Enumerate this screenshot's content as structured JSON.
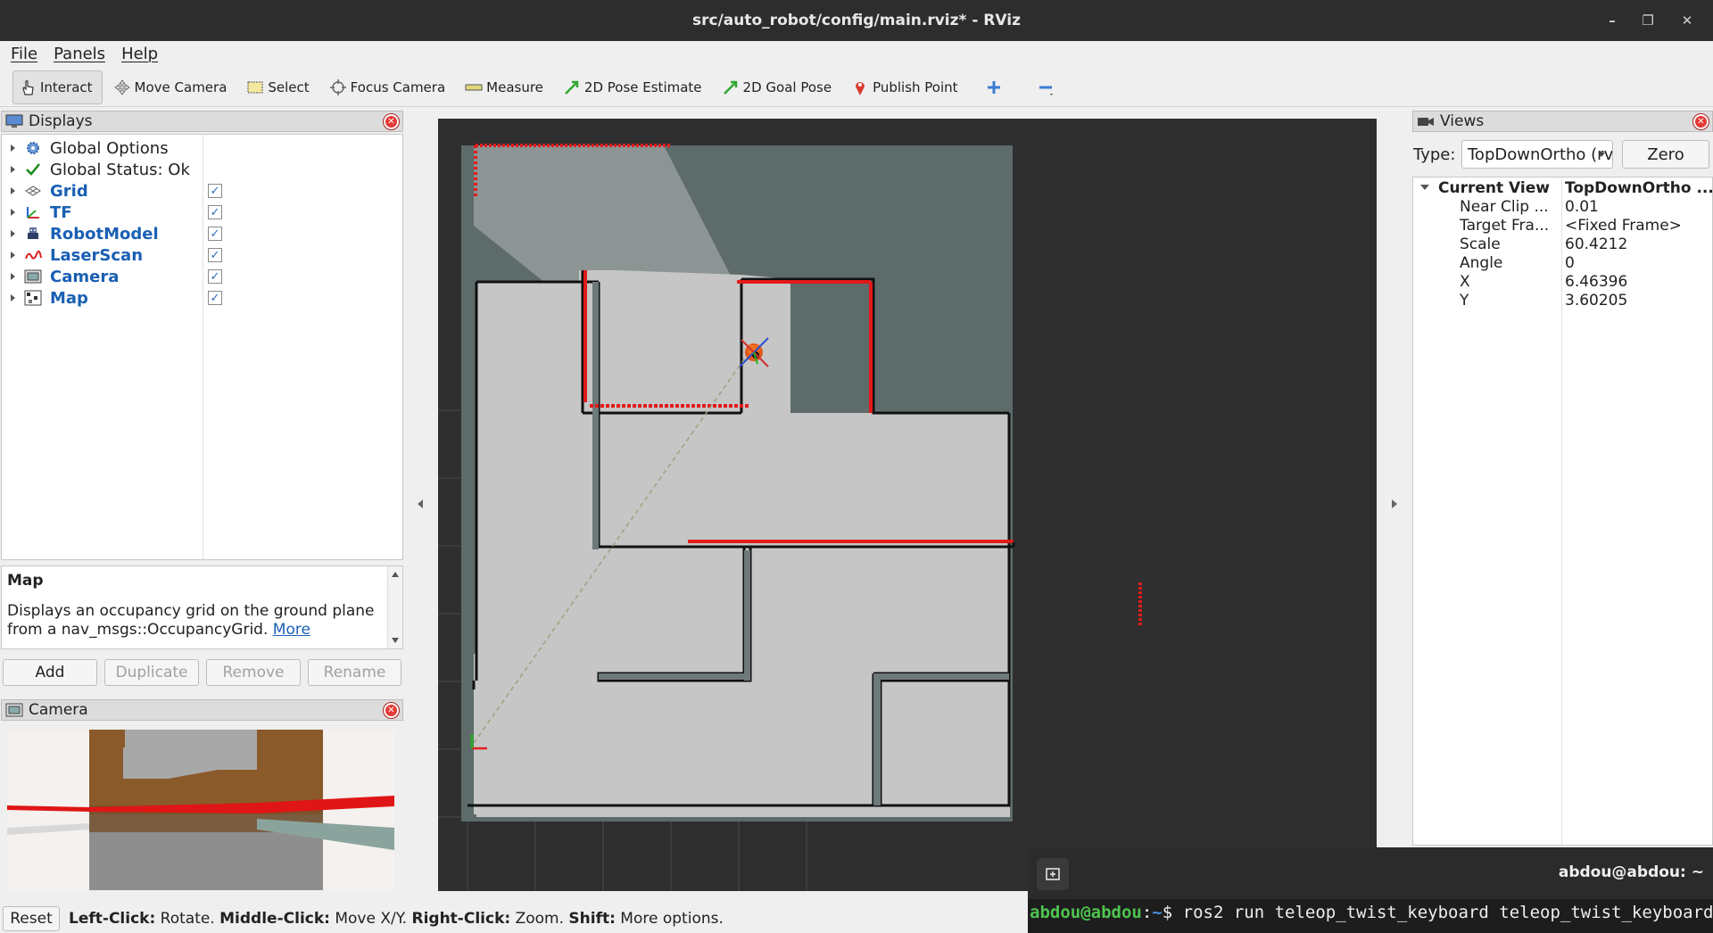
{
  "window": {
    "title": "src/auto_robot/config/main.rviz* - RViz"
  },
  "menu": [
    "File",
    "Panels",
    "Help"
  ],
  "toolbar": {
    "interact": "Interact",
    "move_camera": "Move Camera",
    "select": "Select",
    "focus_camera": "Focus Camera",
    "measure": "Measure",
    "pose_estimate": "2D Pose Estimate",
    "goal_pose": "2D Goal Pose",
    "publish_point": "Publish Point"
  },
  "displays": {
    "title": "Displays",
    "items": [
      {
        "label": "Global Options",
        "checked": null
      },
      {
        "label": "Global Status: Ok",
        "checked": null
      },
      {
        "label": "Grid",
        "checked": true
      },
      {
        "label": "TF",
        "checked": true
      },
      {
        "label": "RobotModel",
        "checked": true
      },
      {
        "label": "LaserScan",
        "checked": true
      },
      {
        "label": "Camera",
        "checked": true
      },
      {
        "label": "Map",
        "checked": true
      }
    ],
    "description_title": "Map",
    "description_text": "Displays an occupancy grid on the ground plane from a nav_msgs::OccupancyGrid.",
    "description_link": "More",
    "buttons": {
      "add": "Add",
      "duplicate": "Duplicate",
      "remove": "Remove",
      "rename": "Rename"
    }
  },
  "camera_panel": {
    "title": "Camera"
  },
  "views": {
    "title": "Views",
    "type_label": "Type:",
    "type_value": "TopDownOrtho (rviz_default_plugins)",
    "zero": "Zero",
    "current_view": {
      "label": "Current View",
      "value": "TopDownOrtho ..."
    },
    "props": [
      {
        "key": "Near Clip ...",
        "value": "0.01"
      },
      {
        "key": "Target Fra...",
        "value": "<Fixed Frame>"
      },
      {
        "key": "Scale",
        "value": "60.4212"
      },
      {
        "key": "Angle",
        "value": "0"
      },
      {
        "key": "X",
        "value": "6.46396"
      },
      {
        "key": "Y",
        "value": "3.60205"
      }
    ]
  },
  "status": {
    "reset": "Reset",
    "k1": "Left-Click:",
    "v1": " Rotate. ",
    "k2": "Middle-Click:",
    "v2": " Move X/Y. ",
    "k3": "Right-Click:",
    "v3": " Zoom. ",
    "k4": "Shift:",
    "v4": " More options."
  },
  "terminal": {
    "title": "abdou@abdou: ~",
    "user": "abdou@abdou",
    "sep": ":",
    "path": "~",
    "prompt": "$ ",
    "command": "ros2 run teleop_twist_keyboard teleop_twist_keyboard"
  },
  "colors": {
    "laser": "#e31a1a",
    "map_free": "#c8c8c8",
    "map_unknown": "#5d6b6b",
    "selection": "#1a5fb4"
  }
}
